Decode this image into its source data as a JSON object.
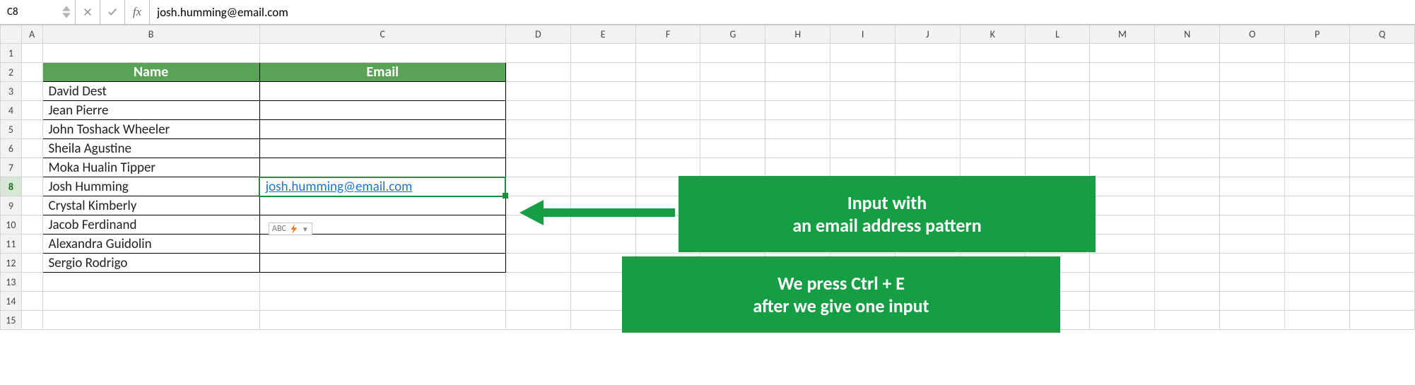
{
  "name_box": {
    "value": "C8"
  },
  "formula_bar": {
    "value": "josh.humming@email.com"
  },
  "columns": [
    "A",
    "B",
    "C",
    "D",
    "E",
    "F",
    "G",
    "H",
    "I",
    "J",
    "K",
    "L",
    "M",
    "N",
    "O",
    "P",
    "Q"
  ],
  "row_count": 15,
  "active_row": 8,
  "table": {
    "headers": {
      "name": "Name",
      "email": "Email"
    },
    "rows": [
      {
        "name": "David Dest",
        "email": ""
      },
      {
        "name": "Jean Pierre",
        "email": ""
      },
      {
        "name": "John Toshack Wheeler",
        "email": ""
      },
      {
        "name": "Sheila Agustine",
        "email": ""
      },
      {
        "name": "Moka Hualin Tipper",
        "email": ""
      },
      {
        "name": "Josh Humming",
        "email": "josh.humming@email.com"
      },
      {
        "name": "Crystal Kimberly",
        "email": ""
      },
      {
        "name": "Jacob Ferdinand",
        "email": ""
      },
      {
        "name": "Alexandra Guidolin",
        "email": ""
      },
      {
        "name": "Sergio Rodrigo",
        "email": ""
      }
    ]
  },
  "flash_hint": {
    "label": "ABC"
  },
  "callouts": {
    "c1_line1": "Input with",
    "c1_line2": "an email address pattern",
    "c2_line1": "We press Ctrl + E",
    "c2_line2": "after we give one input"
  },
  "colors": {
    "accent": "#169e44",
    "tableHead": "#5aa255",
    "link": "#1976d2"
  }
}
